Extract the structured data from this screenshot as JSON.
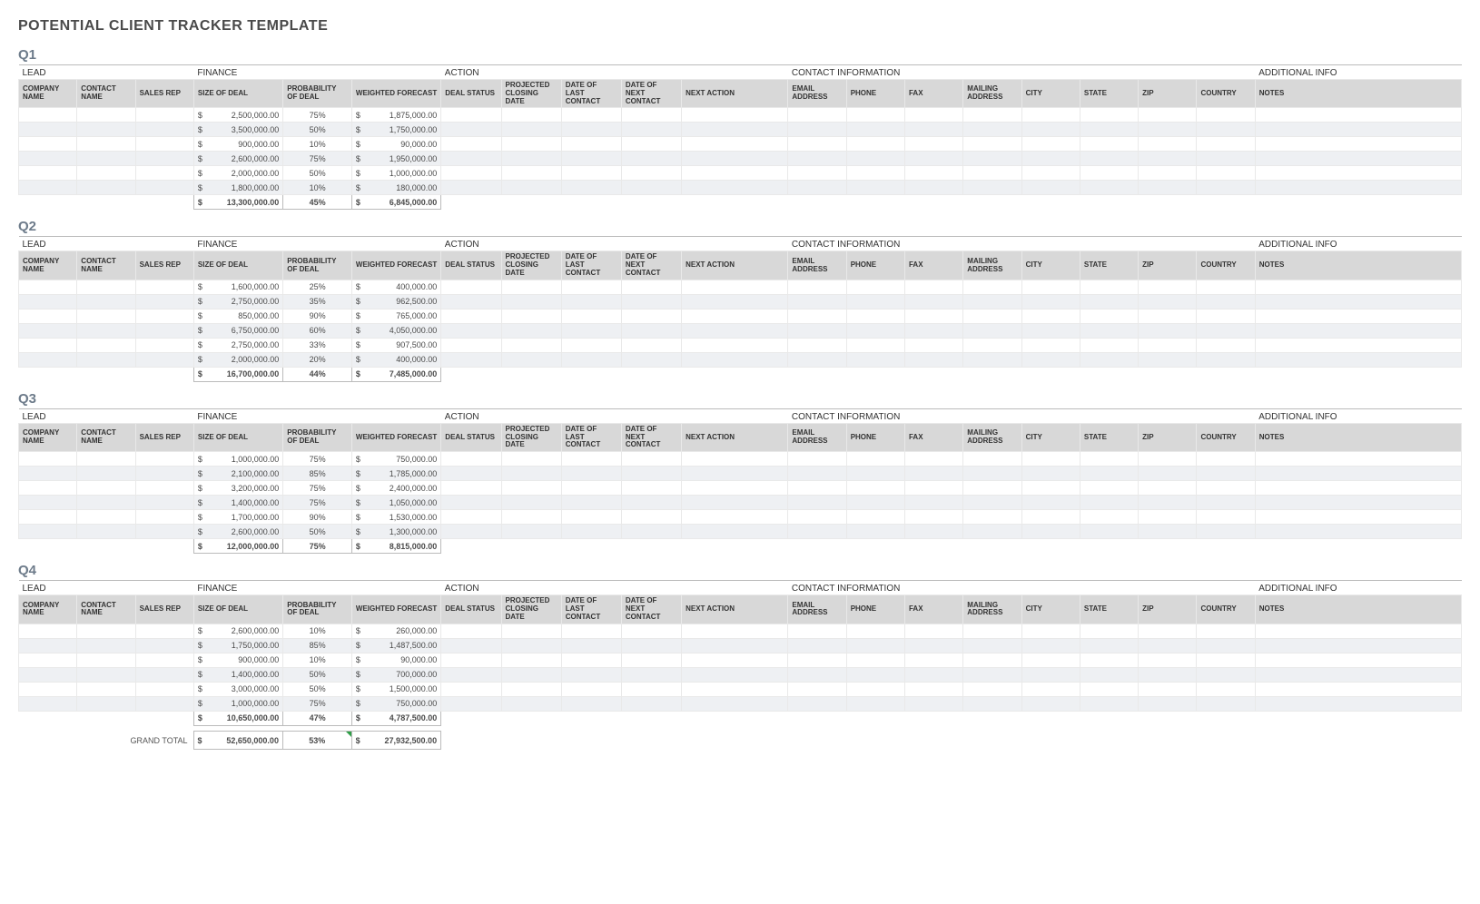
{
  "title": "POTENTIAL CLIENT TRACKER TEMPLATE",
  "groupHeaders": {
    "lead": "LEAD",
    "finance": "FINANCE",
    "action": "ACTION",
    "contact": "CONTACT INFORMATION",
    "additional": "ADDITIONAL INFO"
  },
  "columnHeaders": [
    "COMPANY NAME",
    "CONTACT NAME",
    "SALES REP",
    "SIZE OF DEAL",
    "PROBABILITY OF DEAL",
    "WEIGHTED FORECAST",
    "DEAL STATUS",
    "PROJECTED CLOSING DATE",
    "DATE OF LAST CONTACT",
    "DATE OF NEXT CONTACT",
    "NEXT ACTION",
    "EMAIL ADDRESS",
    "PHONE",
    "FAX",
    "MAILING ADDRESS",
    "CITY",
    "STATE",
    "ZIP",
    "COUNTRY",
    "NOTES"
  ],
  "quarters": [
    {
      "label": "Q1",
      "rows": [
        {
          "size": "2,500,000.00",
          "prob": "75%",
          "wf": "1,875,000.00"
        },
        {
          "size": "3,500,000.00",
          "prob": "50%",
          "wf": "1,750,000.00"
        },
        {
          "size": "900,000.00",
          "prob": "10%",
          "wf": "90,000.00"
        },
        {
          "size": "2,600,000.00",
          "prob": "75%",
          "wf": "1,950,000.00"
        },
        {
          "size": "2,000,000.00",
          "prob": "50%",
          "wf": "1,000,000.00"
        },
        {
          "size": "1,800,000.00",
          "prob": "10%",
          "wf": "180,000.00"
        }
      ],
      "total": {
        "size": "13,300,000.00",
        "prob": "45%",
        "wf": "6,845,000.00"
      }
    },
    {
      "label": "Q2",
      "rows": [
        {
          "size": "1,600,000.00",
          "prob": "25%",
          "wf": "400,000.00"
        },
        {
          "size": "2,750,000.00",
          "prob": "35%",
          "wf": "962,500.00"
        },
        {
          "size": "850,000.00",
          "prob": "90%",
          "wf": "765,000.00"
        },
        {
          "size": "6,750,000.00",
          "prob": "60%",
          "wf": "4,050,000.00"
        },
        {
          "size": "2,750,000.00",
          "prob": "33%",
          "wf": "907,500.00"
        },
        {
          "size": "2,000,000.00",
          "prob": "20%",
          "wf": "400,000.00"
        }
      ],
      "total": {
        "size": "16,700,000.00",
        "prob": "44%",
        "wf": "7,485,000.00"
      }
    },
    {
      "label": "Q3",
      "rows": [
        {
          "size": "1,000,000.00",
          "prob": "75%",
          "wf": "750,000.00"
        },
        {
          "size": "2,100,000.00",
          "prob": "85%",
          "wf": "1,785,000.00"
        },
        {
          "size": "3,200,000.00",
          "prob": "75%",
          "wf": "2,400,000.00"
        },
        {
          "size": "1,400,000.00",
          "prob": "75%",
          "wf": "1,050,000.00"
        },
        {
          "size": "1,700,000.00",
          "prob": "90%",
          "wf": "1,530,000.00"
        },
        {
          "size": "2,600,000.00",
          "prob": "50%",
          "wf": "1,300,000.00"
        }
      ],
      "total": {
        "size": "12,000,000.00",
        "prob": "75%",
        "wf": "8,815,000.00"
      }
    },
    {
      "label": "Q4",
      "rows": [
        {
          "size": "2,600,000.00",
          "prob": "10%",
          "wf": "260,000.00"
        },
        {
          "size": "1,750,000.00",
          "prob": "85%",
          "wf": "1,487,500.00"
        },
        {
          "size": "900,000.00",
          "prob": "10%",
          "wf": "90,000.00"
        },
        {
          "size": "1,400,000.00",
          "prob": "50%",
          "wf": "700,000.00"
        },
        {
          "size": "3,000,000.00",
          "prob": "50%",
          "wf": "1,500,000.00"
        },
        {
          "size": "1,000,000.00",
          "prob": "75%",
          "wf": "750,000.00"
        }
      ],
      "total": {
        "size": "10,650,000.00",
        "prob": "47%",
        "wf": "4,787,500.00"
      }
    }
  ],
  "grand": {
    "label": "GRAND TOTAL",
    "size": "52,650,000.00",
    "prob": "53%",
    "wf": "27,932,500.00"
  }
}
